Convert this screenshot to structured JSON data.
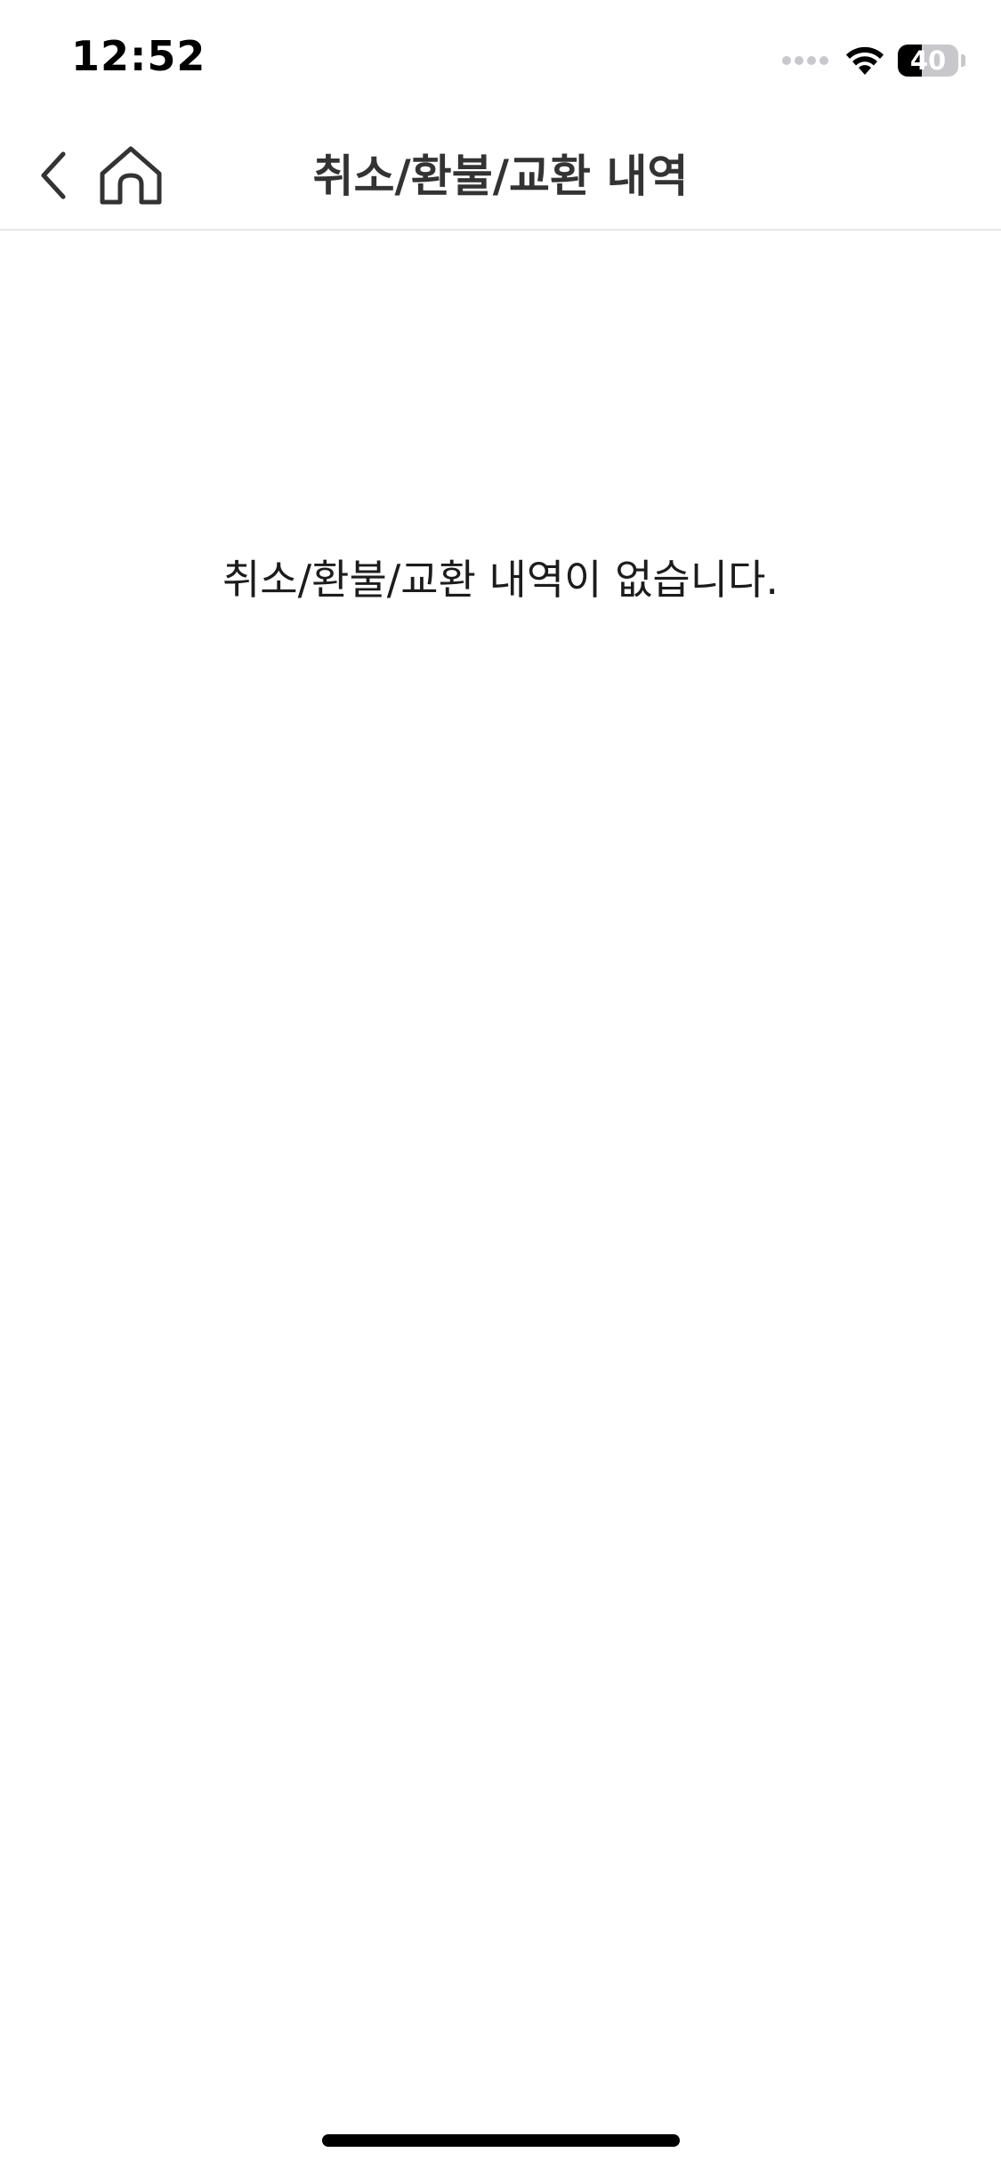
{
  "status_bar": {
    "time": "12:52",
    "battery_level": 40,
    "battery_text": "40",
    "icons": [
      "signal-dots-icon",
      "wifi-icon",
      "battery-icon"
    ]
  },
  "header": {
    "title": "취소/환불/교환 내역",
    "back_icon": "chevron-left-icon",
    "home_icon": "home-icon"
  },
  "main": {
    "empty_message": "취소/환불/교환 내역이 없습니다."
  },
  "colors": {
    "background": "#ffffff",
    "title_text": "#333333",
    "divider": "#e5e5ea"
  }
}
